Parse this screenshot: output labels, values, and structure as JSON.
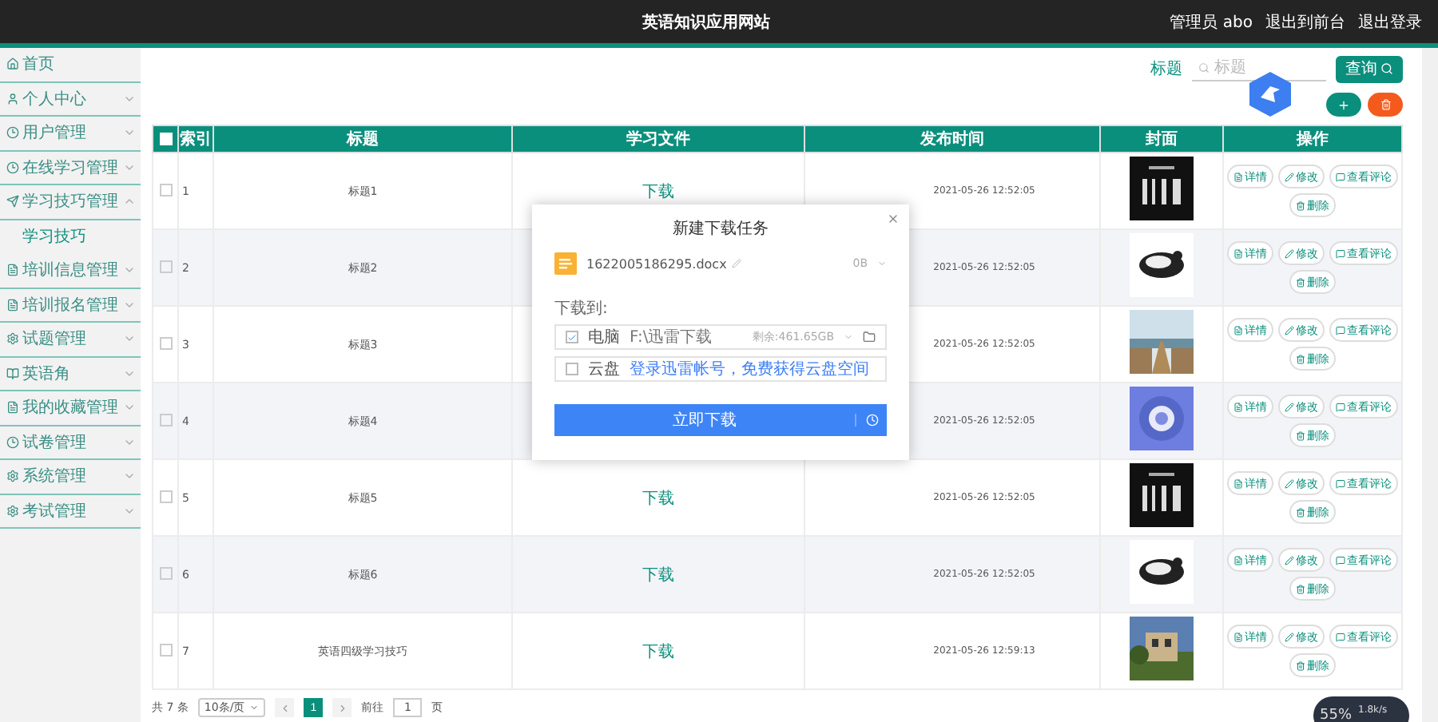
{
  "topbar": {
    "title": "英语知识应用网站",
    "user": "管理员 abo",
    "links": [
      "退出到前台",
      "退出登录"
    ]
  },
  "sidebar": {
    "items": [
      {
        "kind": "link",
        "label": "首页",
        "selected": false
      },
      {
        "kind": "menu",
        "label": "个人中心",
        "expanded": false,
        "selected": false
      },
      {
        "kind": "menu",
        "label": "用户管理",
        "expanded": false,
        "selected": false
      },
      {
        "kind": "menu",
        "label": "在线学习管理",
        "expanded": false,
        "selected": false
      },
      {
        "kind": "menu",
        "label": "学习技巧管理",
        "expanded": true,
        "selected": false,
        "children": [
          {
            "label": "学习技巧",
            "selected": true
          }
        ]
      },
      {
        "kind": "menu",
        "label": "培训信息管理",
        "expanded": false,
        "selected": false
      },
      {
        "kind": "menu",
        "label": "培训报名管理",
        "expanded": false,
        "selected": false
      },
      {
        "kind": "menu",
        "label": "试题管理",
        "expanded": false,
        "selected": false
      },
      {
        "kind": "menu",
        "label": "英语角",
        "expanded": false,
        "selected": false
      },
      {
        "kind": "menu",
        "label": "我的收藏管理",
        "expanded": false,
        "selected": false
      },
      {
        "kind": "menu",
        "label": "试卷管理",
        "expanded": false,
        "selected": false
      },
      {
        "kind": "menu",
        "label": "系统管理",
        "expanded": false,
        "selected": false
      },
      {
        "kind": "menu",
        "label": "考试管理",
        "expanded": false,
        "selected": false
      }
    ]
  },
  "search": {
    "label": "标题",
    "placeholder": "标题",
    "button": "查询"
  },
  "table": {
    "select_all": false,
    "columns": [
      "索引",
      "标题",
      "学习文件",
      "发布时间",
      "封面",
      "操作"
    ],
    "rows": [
      {
        "selected": false,
        "index": "1",
        "title": "标题1",
        "file": "下载",
        "date": "2021-05-26 12:52:05",
        "actions": [
          "详情",
          "修改",
          "查看评论",
          "删除"
        ]
      },
      {
        "selected": false,
        "index": "2",
        "title": "标题2",
        "date": "2021-05-26 12:52:05",
        "actions": [
          "详情",
          "修改",
          "查看评论",
          "删除"
        ]
      },
      {
        "selected": false,
        "index": "3",
        "title": "标题3",
        "date": "2021-05-26 12:52:05",
        "actions": [
          "详情",
          "修改",
          "查看评论",
          "删除"
        ]
      },
      {
        "selected": false,
        "index": "4",
        "title": "标题4",
        "date": "2021-05-26 12:52:05",
        "actions": [
          "详情",
          "修改",
          "查看评论",
          "删除"
        ]
      },
      {
        "selected": false,
        "index": "5",
        "title": "标题5",
        "file": "下载",
        "date": "2021-05-26 12:52:05",
        "actions": [
          "详情",
          "修改",
          "查看评论",
          "删除"
        ]
      },
      {
        "selected": false,
        "index": "6",
        "title": "标题6",
        "file": "下载",
        "date": "2021-05-26 12:52:05",
        "actions": [
          "详情",
          "修改",
          "查看评论",
          "删除"
        ]
      },
      {
        "selected": false,
        "index": "7",
        "title": "英语四级学习技巧",
        "file": "下载",
        "date": "2021-05-26 12:59:13",
        "actions": [
          "详情",
          "修改",
          "查看评论",
          "删除"
        ]
      }
    ]
  },
  "pagination": {
    "total": "共 7 条",
    "page_size": "10条/页",
    "pages": [
      {
        "label": "1",
        "selected": true
      }
    ],
    "goto_label": "前往",
    "goto_value": "1",
    "goto_suffix": "页"
  },
  "dialog": {
    "title": "新建下载任务",
    "file_name": "1622005186295.docx",
    "size": "0B",
    "save_label": "下载到:",
    "targets": [
      {
        "kind": "local",
        "checked": true,
        "label": "电脑",
        "path": "F:\\迅雷下载",
        "free": "剩余:461.65GB"
      },
      {
        "kind": "cloud",
        "checked": false,
        "label": "云盘",
        "link": "登录迅雷帐号，免费获得云盘空间"
      }
    ],
    "button": "立即下载"
  },
  "speed_widget": {
    "percent": "55%",
    "speed": "1.8k/s"
  }
}
